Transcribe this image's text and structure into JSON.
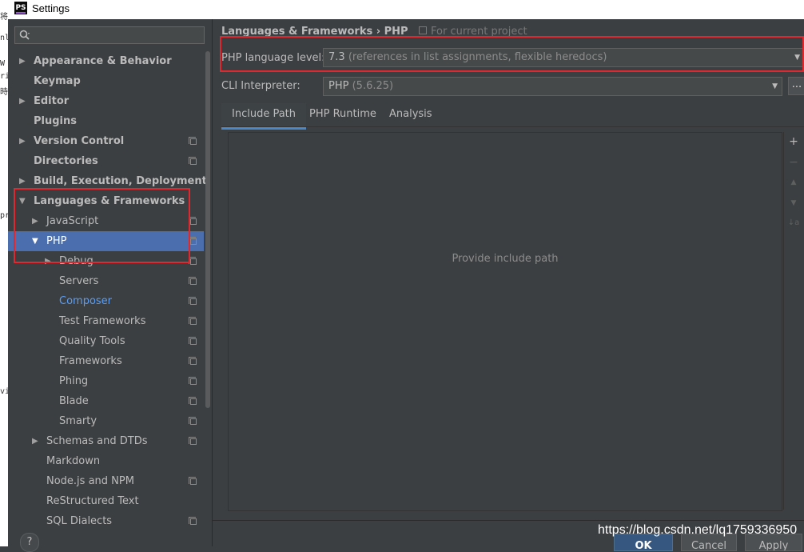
{
  "window": {
    "title": "Settings",
    "logo": "PS"
  },
  "background_fragments": [
    "将",
    "nl",
    "W",
    "ri",
    "時",
    "pr",
    "vi"
  ],
  "sidebar": {
    "search_placeholder": "",
    "items": [
      {
        "label": "Appearance & Behavior",
        "level": 0,
        "bold": true,
        "arrow": "▶",
        "project_icon": false
      },
      {
        "label": "Keymap",
        "level": 0,
        "bold": true,
        "arrow": "",
        "project_icon": false
      },
      {
        "label": "Editor",
        "level": 0,
        "bold": true,
        "arrow": "▶",
        "project_icon": false
      },
      {
        "label": "Plugins",
        "level": 0,
        "bold": true,
        "arrow": "",
        "project_icon": false
      },
      {
        "label": "Version Control",
        "level": 0,
        "bold": true,
        "arrow": "▶",
        "project_icon": true
      },
      {
        "label": "Directories",
        "level": 0,
        "bold": true,
        "arrow": "",
        "project_icon": true
      },
      {
        "label": "Build, Execution, Deployment",
        "level": 0,
        "bold": true,
        "arrow": "▶",
        "project_icon": false
      },
      {
        "label": "Languages & Frameworks",
        "level": 0,
        "bold": true,
        "arrow": "▼",
        "project_icon": false
      },
      {
        "label": "JavaScript",
        "level": 1,
        "bold": false,
        "arrow": "▶",
        "project_icon": true
      },
      {
        "label": "PHP",
        "level": 1,
        "bold": false,
        "arrow": "▼",
        "project_icon": true,
        "selected": true
      },
      {
        "label": "Debug",
        "level": 2,
        "bold": false,
        "arrow": "▶",
        "project_icon": true
      },
      {
        "label": "Servers",
        "level": 2,
        "bold": false,
        "arrow": "",
        "project_icon": true
      },
      {
        "label": "Composer",
        "level": 2,
        "bold": false,
        "arrow": "",
        "project_icon": true,
        "link": true
      },
      {
        "label": "Test Frameworks",
        "level": 2,
        "bold": false,
        "arrow": "",
        "project_icon": true
      },
      {
        "label": "Quality Tools",
        "level": 2,
        "bold": false,
        "arrow": "",
        "project_icon": true
      },
      {
        "label": "Frameworks",
        "level": 2,
        "bold": false,
        "arrow": "",
        "project_icon": true
      },
      {
        "label": "Phing",
        "level": 2,
        "bold": false,
        "arrow": "",
        "project_icon": true
      },
      {
        "label": "Blade",
        "level": 2,
        "bold": false,
        "arrow": "",
        "project_icon": true
      },
      {
        "label": "Smarty",
        "level": 2,
        "bold": false,
        "arrow": "",
        "project_icon": true
      },
      {
        "label": "Schemas and DTDs",
        "level": 1,
        "bold": false,
        "arrow": "▶",
        "project_icon": true
      },
      {
        "label": "Markdown",
        "level": 1,
        "bold": false,
        "arrow": "",
        "project_icon": false
      },
      {
        "label": "Node.js and NPM",
        "level": 1,
        "bold": false,
        "arrow": "",
        "project_icon": true
      },
      {
        "label": "ReStructured Text",
        "level": 1,
        "bold": false,
        "arrow": "",
        "project_icon": false
      },
      {
        "label": "SQL Dialects",
        "level": 1,
        "bold": false,
        "arrow": "",
        "project_icon": true
      }
    ],
    "help_label": "?"
  },
  "main": {
    "breadcrumb": "Languages & Frameworks  ›  PHP",
    "for_project": "For current project",
    "language_level": {
      "label": "PHP language level:",
      "value": "7.3",
      "hint": "(references in list assignments, flexible heredocs)"
    },
    "cli_interpreter": {
      "label": "CLI Interpreter:",
      "value": "PHP",
      "hint": "(5.6.25)",
      "browse_label": "..."
    },
    "tabs": [
      "Include Path",
      "PHP Runtime",
      "Analysis"
    ],
    "empty_text": "Provide include path",
    "tools": [
      "+",
      "−",
      "▲",
      "▼",
      "↓a"
    ]
  },
  "footer": {
    "ok": "OK",
    "cancel": "Cancel",
    "apply": "Apply"
  },
  "watermark": "https://blog.csdn.net/lq1759336950",
  "colors": {
    "accent": "#4b6eaf",
    "link": "#589df6",
    "highlight_box": "#e0292e",
    "background": "#3c3f41"
  }
}
